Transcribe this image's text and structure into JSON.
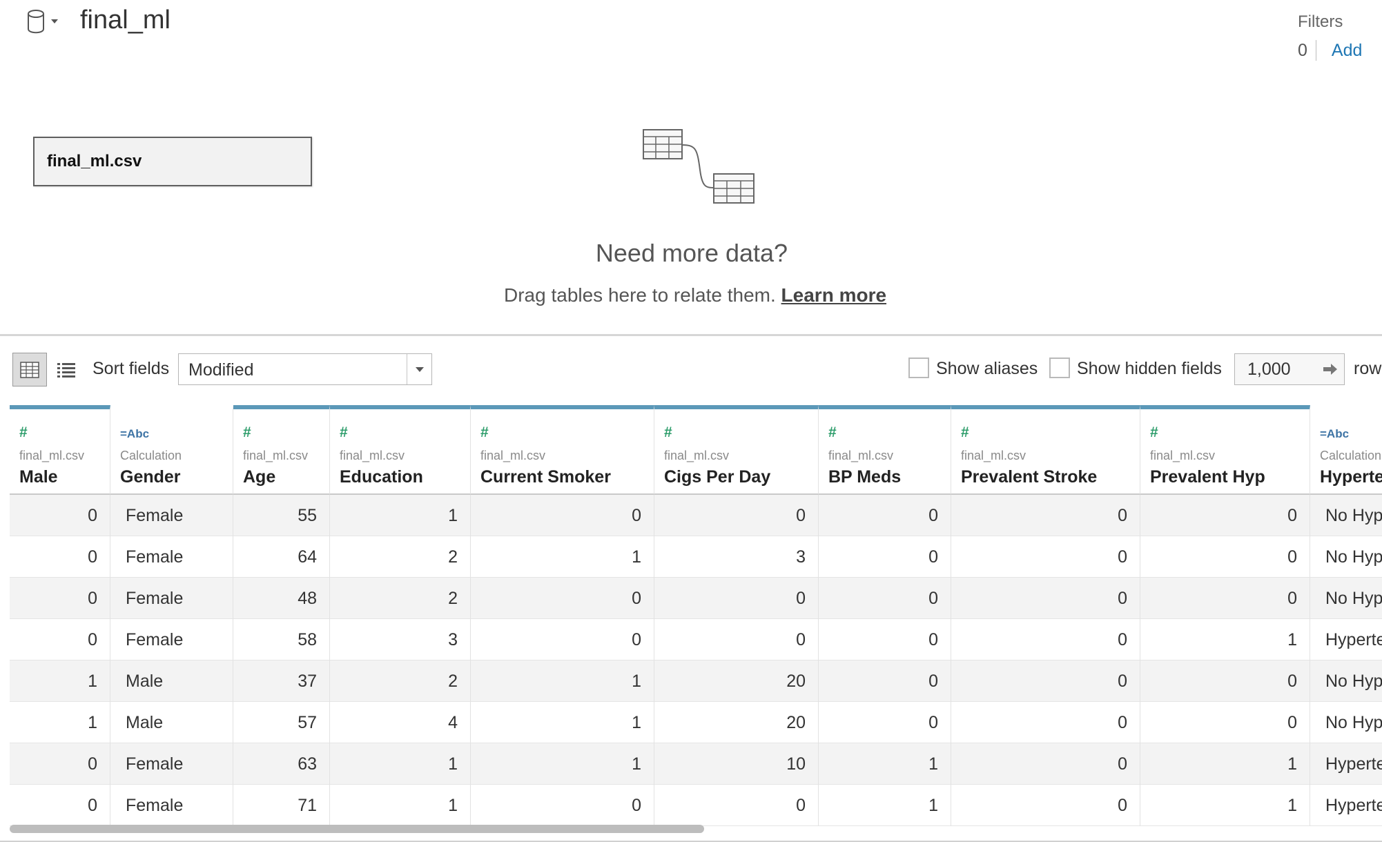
{
  "header": {
    "datasource_title": "final_ml",
    "datasource_icon": "database-icon",
    "filters_label": "Filters",
    "filters_count": "0",
    "filters_add": "Add"
  },
  "canvas": {
    "table_name": "final_ml.csv",
    "relate_icon": "relate-tables-icon",
    "relate_title": "Need more data?",
    "relate_text": "Drag tables here to relate them.",
    "relate_link": "Learn more"
  },
  "toolbar": {
    "grid_view_icon": "grid-view-icon",
    "list_view_icon": "list-view-icon",
    "sort_label": "Sort fields",
    "sort_value": "Modified",
    "show_aliases": "Show aliases",
    "show_aliases_checked": false,
    "show_hidden": "Show hidden fields",
    "show_hidden_checked": false,
    "rows_value": "1,000",
    "rows_label": "rows"
  },
  "colors": {
    "accent_bar": "#5b98b8",
    "number_type": "#2c9c6a",
    "string_type": "#3e74a5",
    "link": "#1f77b4"
  },
  "grid": {
    "columns": [
      {
        "type": "#",
        "source": "final_ml.csv",
        "name": "Male",
        "align": "num",
        "bar": true
      },
      {
        "type": "=Abc",
        "source": "Calculation",
        "name": "Gender",
        "align": "txt",
        "bar": false
      },
      {
        "type": "#",
        "source": "final_ml.csv",
        "name": "Age",
        "align": "num",
        "bar": true
      },
      {
        "type": "#",
        "source": "final_ml.csv",
        "name": "Education",
        "align": "num",
        "bar": true
      },
      {
        "type": "#",
        "source": "final_ml.csv",
        "name": "Current Smoker",
        "align": "num",
        "bar": true
      },
      {
        "type": "#",
        "source": "final_ml.csv",
        "name": "Cigs Per Day",
        "align": "num",
        "bar": true
      },
      {
        "type": "#",
        "source": "final_ml.csv",
        "name": "BP Meds",
        "align": "num",
        "bar": true
      },
      {
        "type": "#",
        "source": "final_ml.csv",
        "name": "Prevalent Stroke",
        "align": "num",
        "bar": true
      },
      {
        "type": "#",
        "source": "final_ml.csv",
        "name": "Prevalent Hyp",
        "align": "num",
        "bar": true
      },
      {
        "type": "=Abc",
        "source": "Calculation",
        "name": "Hyperten",
        "align": "txt",
        "bar": false
      }
    ],
    "rows": [
      [
        "0",
        "Female",
        "55",
        "1",
        "0",
        "0",
        "0",
        "0",
        "0",
        "No Hype"
      ],
      [
        "0",
        "Female",
        "64",
        "2",
        "1",
        "3",
        "0",
        "0",
        "0",
        "No Hype"
      ],
      [
        "0",
        "Female",
        "48",
        "2",
        "0",
        "0",
        "0",
        "0",
        "0",
        "No Hype"
      ],
      [
        "0",
        "Female",
        "58",
        "3",
        "0",
        "0",
        "0",
        "0",
        "1",
        "Hyperte"
      ],
      [
        "1",
        "Male",
        "37",
        "2",
        "1",
        "20",
        "0",
        "0",
        "0",
        "No Hype"
      ],
      [
        "1",
        "Male",
        "57",
        "4",
        "1",
        "20",
        "0",
        "0",
        "0",
        "No Hype"
      ],
      [
        "0",
        "Female",
        "63",
        "1",
        "1",
        "10",
        "1",
        "0",
        "1",
        "Hyperte"
      ],
      [
        "0",
        "Female",
        "71",
        "1",
        "0",
        "0",
        "1",
        "0",
        "1",
        "Hyperte"
      ]
    ]
  }
}
